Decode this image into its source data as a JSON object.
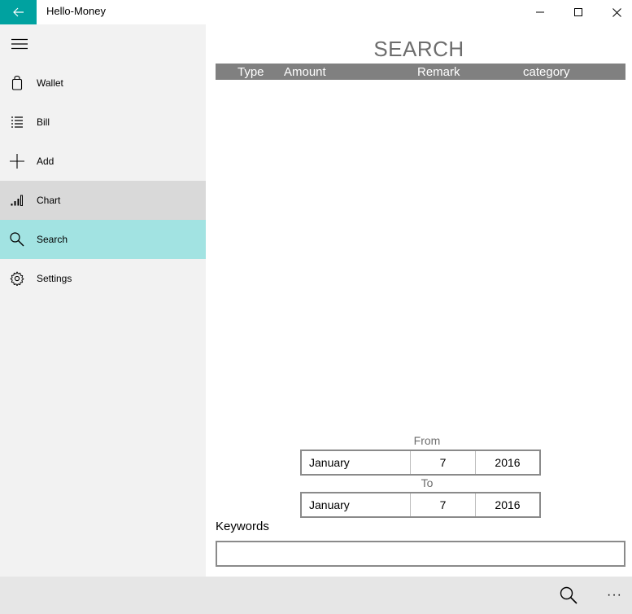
{
  "window": {
    "title": "Hello-Money",
    "accent_color": "#00a2a0"
  },
  "sidebar": {
    "items": [
      {
        "label": "Wallet",
        "icon": "wallet-icon",
        "state": "normal"
      },
      {
        "label": "Bill",
        "icon": "list-icon",
        "state": "normal"
      },
      {
        "label": "Add",
        "icon": "plus-icon",
        "state": "normal"
      },
      {
        "label": "Chart",
        "icon": "chart-icon",
        "state": "hover"
      },
      {
        "label": "Search",
        "icon": "search-icon",
        "state": "selected"
      },
      {
        "label": "Settings",
        "icon": "gear-icon",
        "state": "normal"
      }
    ],
    "selected_color": "#a2e3e2",
    "hover_color": "#d9d9d9"
  },
  "main": {
    "title": "SEARCH",
    "table": {
      "columns": [
        "Type",
        "Amount",
        "Remark",
        "category"
      ],
      "rows": []
    },
    "from": {
      "label": "From",
      "month": "January",
      "day": "7",
      "year": "2016"
    },
    "to": {
      "label": "To",
      "month": "January",
      "day": "7",
      "year": "2016"
    },
    "keywords": {
      "label": "Keywords",
      "value": "",
      "placeholder": ""
    }
  },
  "appbar": {
    "more_label": "···"
  }
}
